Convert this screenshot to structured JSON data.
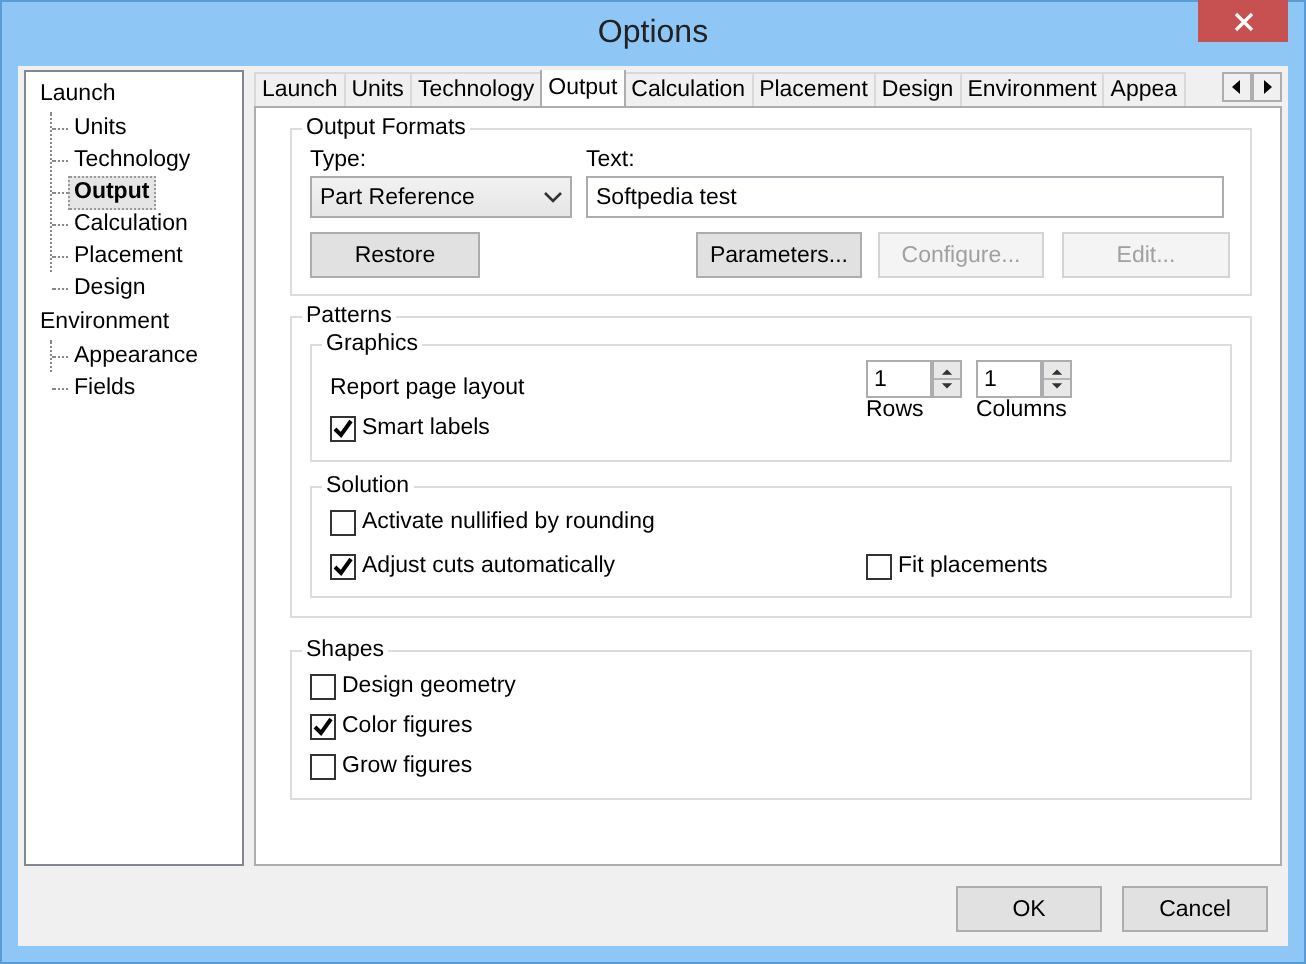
{
  "window": {
    "title": "Options"
  },
  "tree": [
    {
      "label": "Launch",
      "selected": false,
      "children": [
        {
          "label": "Units",
          "selected": false
        },
        {
          "label": "Technology",
          "selected": false
        },
        {
          "label": "Output",
          "selected": true
        },
        {
          "label": "Calculation",
          "selected": false
        },
        {
          "label": "Placement",
          "selected": false
        },
        {
          "label": "Design",
          "selected": false
        }
      ]
    },
    {
      "label": "Environment",
      "selected": false,
      "children": [
        {
          "label": "Appearance",
          "selected": false
        },
        {
          "label": "Fields",
          "selected": false
        }
      ]
    }
  ],
  "tabs": [
    {
      "label": "Launch",
      "selected": false
    },
    {
      "label": "Units",
      "selected": false
    },
    {
      "label": "Technology",
      "selected": false
    },
    {
      "label": "Output",
      "selected": true
    },
    {
      "label": "Calculation",
      "selected": false
    },
    {
      "label": "Placement",
      "selected": false
    },
    {
      "label": "Design",
      "selected": false
    },
    {
      "label": "Environment",
      "selected": false
    },
    {
      "label": "Appea",
      "selected": false
    }
  ],
  "output_formats": {
    "title": "Output Formats",
    "type_label": "Type:",
    "type_value": "Part Reference",
    "text_label": "Text:",
    "text_value": "Softpedia test",
    "buttons": [
      {
        "label": "Restore",
        "disabled": false
      },
      {
        "label": "Parameters...",
        "disabled": false
      },
      {
        "label": "Configure...",
        "disabled": true
      },
      {
        "label": "Edit...",
        "disabled": true
      }
    ]
  },
  "patterns": {
    "title": "Patterns",
    "graphics": {
      "title": "Graphics",
      "report_label": "Report page layout",
      "smart_labels": {
        "label": "Smart labels",
        "checked": true
      },
      "spinners": [
        {
          "value": "1",
          "label": "Rows"
        },
        {
          "value": "1",
          "label": "Columns"
        }
      ]
    },
    "solution": {
      "title": "Solution",
      "rows": [
        [
          {
            "label": "Activate nullified by rounding",
            "checked": false
          }
        ],
        [
          {
            "label": "Adjust cuts automatically",
            "checked": true
          },
          {
            "label": "Fit placements",
            "checked": false
          }
        ]
      ]
    }
  },
  "shapes": {
    "title": "Shapes",
    "options": [
      {
        "label": "Design geometry",
        "checked": false
      },
      {
        "label": "Color figures",
        "checked": true
      },
      {
        "label": "Grow figures",
        "checked": false
      }
    ]
  },
  "buttons": [
    "OK",
    "Cancel"
  ]
}
